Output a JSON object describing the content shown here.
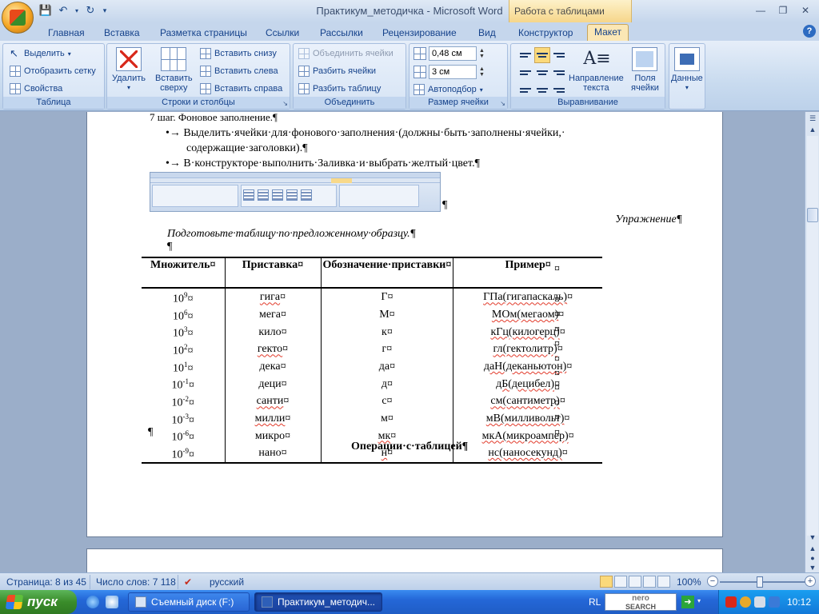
{
  "window": {
    "title": "Практикум_методичка - Microsoft Word",
    "context_tab_group": "Работа с таблицами"
  },
  "tabs": [
    "Главная",
    "Вставка",
    "Разметка страницы",
    "Ссылки",
    "Рассылки",
    "Рецензирование",
    "Вид",
    "Конструктор",
    "Макет"
  ],
  "ribbon": {
    "table_group": {
      "label": "Таблица",
      "select": "Выделить",
      "show_grid": "Отобразить сетку",
      "properties": "Свойства"
    },
    "rows_cols_group": {
      "label": "Строки и столбцы",
      "delete": "Удалить",
      "insert_above_1": "Вставить",
      "insert_above_2": "сверху",
      "insert_below": "Вставить снизу",
      "insert_left": "Вставить слева",
      "insert_right": "Вставить справа"
    },
    "merge_group": {
      "label": "Объединить",
      "merge_cells": "Объединить ячейки",
      "split_cells": "Разбить ячейки",
      "split_table": "Разбить таблицу"
    },
    "cell_size_group": {
      "label": "Размер ячейки",
      "height": "0,48 см",
      "width": "3 см",
      "autofit": "Автоподбор"
    },
    "align_group": {
      "label": "Выравнивание",
      "direction_1": "Направление",
      "direction_2": "текста",
      "margins_1": "Поля",
      "margins_2": "ячейки"
    },
    "data_group": {
      "label": "Данные"
    }
  },
  "document": {
    "step_line": "7 шаг. Фоновое заполнение.¶",
    "bullet1_line1": "•→ Выделить·ячейки·для·фонового·заполнения·(должны·быть·заполнены·ячейки,·",
    "bullet1_line2": "содержащие·заголовки).¶",
    "bullet2": "•→ В·конструкторе·выполнить·Заливка·и·выбрать·желтый·цвет.¶",
    "pilcrow_after_img": "¶",
    "exercise_title": "Упражнение¶",
    "exercise_text": "Подготовьте·таблицу·по·предложенному·образцу.¶",
    "empty_para": "¶",
    "table": {
      "headers": [
        "Множитель¤",
        "Приставка¤",
        "Обозначение·приставки¤",
        "Пример¤"
      ],
      "row_end": "¤",
      "rows": [
        {
          "mult": "10",
          "exp": "9",
          "prefix": "гига",
          "sym": "Г",
          "example": "ГПа(гигапаскаль)"
        },
        {
          "mult": "10",
          "exp": "6",
          "prefix": "мега",
          "sym": "М",
          "example": "МОм(мегаом)"
        },
        {
          "mult": "10",
          "exp": "3",
          "prefix": "кило",
          "sym": "к",
          "example": "кГц(килогерц)"
        },
        {
          "mult": "10",
          "exp": "2",
          "prefix": "гекто",
          "sym": "г",
          "example": "гл(гектолитр)"
        },
        {
          "mult": "10",
          "exp": "1",
          "prefix": "дека",
          "sym": "да",
          "example": "даН(деканьютон)"
        },
        {
          "mult": "10",
          "exp": "-1",
          "prefix": "деци",
          "sym": "д",
          "example": "дБ(децибел)"
        },
        {
          "mult": "10",
          "exp": "-2",
          "prefix": "санти",
          "sym": "с",
          "example": "см(сантиметр)"
        },
        {
          "mult": "10",
          "exp": "-3",
          "prefix": "милли",
          "sym": "м",
          "example": "мВ(милливольт)"
        },
        {
          "mult": "10",
          "exp": "-6",
          "prefix": "микро",
          "sym": "мк",
          "example": "мкА(микроампер)"
        },
        {
          "mult": "10",
          "exp": "-9",
          "prefix": "нано",
          "sym": "н",
          "example": "нс(наносекунд)"
        }
      ]
    },
    "after_table": "¶",
    "section_title": "Операции·с·таблицей¶"
  },
  "statusbar": {
    "page": "Страница: 8 из 45",
    "words": "Число слов: 7 118",
    "language": "русский",
    "zoom": "100%"
  },
  "taskbar": {
    "start": "пуск",
    "task1": "Съемный диск (F:)",
    "task2": "Практикум_методич...",
    "lang": "RL",
    "nero_1": "nero",
    "nero_2": "SEARCH",
    "clock": "10:12"
  }
}
